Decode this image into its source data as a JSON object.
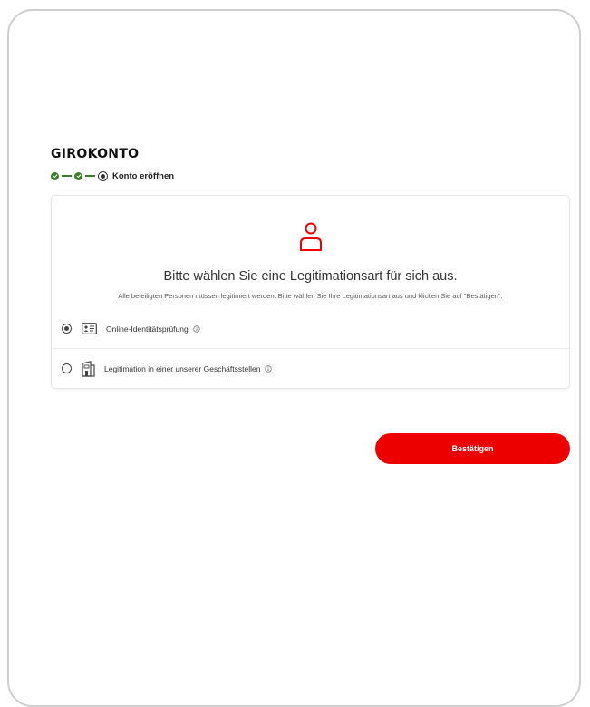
{
  "header": {
    "title": "GIROKONTO"
  },
  "stepper": {
    "steps_done": 2,
    "current_label": "Konto eröffnen"
  },
  "card": {
    "headline": "Bitte wählen Sie eine Legitimationsart für sich aus.",
    "subline": "Alle beteiligten Personen müssen legitimiert werden. Bitte wählen Sie Ihre Legitimationsart aus und klicken Sie auf \"Bestätigen\".",
    "options": [
      {
        "label": "Online-Identitätsprüfung",
        "selected": true,
        "icon": "id-card-icon"
      },
      {
        "label": "Legitimation in einer unserer Geschäftsstellen",
        "selected": false,
        "icon": "branch-building-icon"
      }
    ]
  },
  "actions": {
    "confirm_label": "Bestätigen"
  },
  "colors": {
    "accent": "#ec0000",
    "done": "#3f7d2e"
  }
}
